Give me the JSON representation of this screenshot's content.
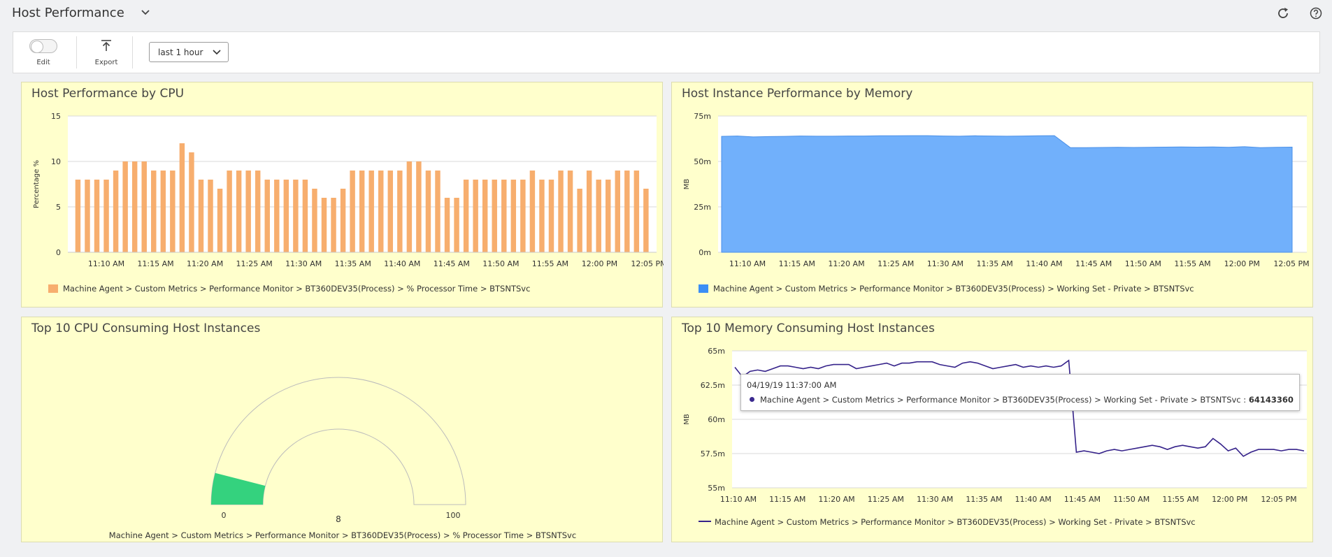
{
  "header": {
    "title": "Host Performance",
    "icons": [
      "chevron-down-icon",
      "refresh-icon",
      "help-icon"
    ]
  },
  "toolbar": {
    "edit_label": "Edit",
    "export_label": "Export",
    "time_range": "last 1 hour"
  },
  "colors": {
    "cpu_bar": "#f7ae6e",
    "memory_area": "#71b0fb",
    "memory_line": "#35228a",
    "gauge_fill": "#34d27e",
    "panel_bg": "#ffffcc"
  },
  "panels": {
    "cpu": {
      "title": "Host Performance by CPU"
    },
    "memory": {
      "title": "Host Instance Performance by Memory"
    },
    "gauge": {
      "title": "Top 10 CPU Consuming Host Instances"
    },
    "memory_top": {
      "title": "Top 10 Memory Consuming Host Instances"
    }
  },
  "tooltip": {
    "date": "04/19/19 11:37:00 AM",
    "series": "Machine Agent > Custom Metrics > Performance Monitor > BT360DEV35(Process) > Working Set - Private > BTSNTSvc :",
    "value": "64143360"
  },
  "chart_data": [
    {
      "type": "bar",
      "title": "Host Performance by CPU",
      "ylabel": "Percentage %",
      "ylim": [
        0,
        15
      ],
      "y_ticks": [
        "15",
        "10",
        "5",
        "0"
      ],
      "x_ticks": [
        "11:10 AM",
        "11:15 AM",
        "11:20 AM",
        "11:25 AM",
        "11:30 AM",
        "11:35 AM",
        "11:40 AM",
        "11:45 AM",
        "11:50 AM",
        "11:55 AM",
        "12:00 PM",
        "12:05 PM"
      ],
      "series": [
        {
          "name": "Machine Agent > Custom Metrics > Performance Monitor > BT360DEV35(Process) > % Processor Time > BTSNTSvc",
          "values": [
            8,
            8,
            8,
            8,
            9,
            10,
            10,
            10,
            9,
            9,
            9,
            12,
            11,
            8,
            8,
            7,
            9,
            9,
            9,
            9,
            8,
            8,
            8,
            8,
            8,
            7,
            6,
            6,
            7,
            9,
            9,
            9,
            9,
            9,
            9,
            10,
            10,
            9,
            9,
            6,
            6,
            8,
            8,
            8,
            8,
            8,
            8,
            8,
            9,
            8,
            8,
            9,
            9,
            7,
            9,
            8,
            8,
            9,
            9,
            9,
            7
          ]
        }
      ]
    },
    {
      "type": "area",
      "title": "Host Instance Performance by Memory",
      "ylabel": "MB",
      "ylim": [
        0,
        75
      ],
      "y_ticks": [
        "75m",
        "50m",
        "25m",
        "0m"
      ],
      "x_ticks": [
        "11:10 AM",
        "11:15 AM",
        "11:20 AM",
        "11:25 AM",
        "11:30 AM",
        "11:35 AM",
        "11:40 AM",
        "11:45 AM",
        "11:50 AM",
        "11:55 AM",
        "12:00 PM",
        "12:05 PM"
      ],
      "series": [
        {
          "name": "Machine Agent > Custom Metrics > Performance Monitor > BT360DEV35(Process) > Working Set - Private > BTSNTSvc",
          "values": [
            63.8,
            64.0,
            63.5,
            63.7,
            63.8,
            64.0,
            63.9,
            63.9,
            64.0,
            64.0,
            64.1,
            64.1,
            64.2,
            64.2,
            64.0,
            63.9,
            64.1,
            64.0,
            63.9,
            64.0,
            64.1,
            64.2,
            57.6,
            57.6,
            57.7,
            57.8,
            57.7,
            57.8,
            57.9,
            58.0,
            57.9,
            58.0,
            57.8,
            58.1,
            57.6,
            57.8,
            57.9
          ]
        }
      ]
    },
    {
      "type": "gauge",
      "title": "Top 10 CPU Consuming Host Instances",
      "min": 0,
      "max": 100,
      "value": 8,
      "min_label": "0",
      "max_label": "100",
      "value_label": "8",
      "legend": "Machine Agent > Custom Metrics > Performance Monitor > BT360DEV35(Process) > % Processor Time > BTSNTSvc"
    },
    {
      "type": "line",
      "title": "Top 10 Memory Consuming Host Instances",
      "ylabel": "MB",
      "ylim": [
        55,
        65
      ],
      "y_ticks": [
        "65m",
        "62.5m",
        "60m",
        "57.5m",
        "55m"
      ],
      "x_ticks": [
        "11:10 AM",
        "11:15 AM",
        "11:20 AM",
        "11:25 AM",
        "11:30 AM",
        "11:35 AM",
        "11:40 AM",
        "11:45 AM",
        "11:50 AM",
        "11:55 AM",
        "12:00 PM",
        "12:05 PM"
      ],
      "series": [
        {
          "name": "Machine Agent > Custom Metrics > Performance Monitor > BT360DEV35(Process) > Working Set - Private > BTSNTSvc",
          "values": [
            63.8,
            63.1,
            63.5,
            63.6,
            63.5,
            63.7,
            63.9,
            63.9,
            63.8,
            63.7,
            63.8,
            63.7,
            63.9,
            64.0,
            64.0,
            64.0,
            63.7,
            63.8,
            63.9,
            64.0,
            64.1,
            63.9,
            64.1,
            64.1,
            64.2,
            64.2,
            64.2,
            64.0,
            63.9,
            63.8,
            64.1,
            64.2,
            64.1,
            63.9,
            63.7,
            63.8,
            63.9,
            64.0,
            63.8,
            63.9,
            63.8,
            63.9,
            63.8,
            63.9,
            64.3,
            57.6,
            57.7,
            57.6,
            57.5,
            57.7,
            57.8,
            57.7,
            57.8,
            57.9,
            58.0,
            58.1,
            58.0,
            57.8,
            58.0,
            58.1,
            58.0,
            57.9,
            58.0,
            58.6,
            58.2,
            57.7,
            57.9,
            57.3,
            57.6,
            57.8,
            57.8,
            57.8,
            57.7,
            57.8,
            57.8,
            57.7
          ]
        }
      ]
    }
  ]
}
